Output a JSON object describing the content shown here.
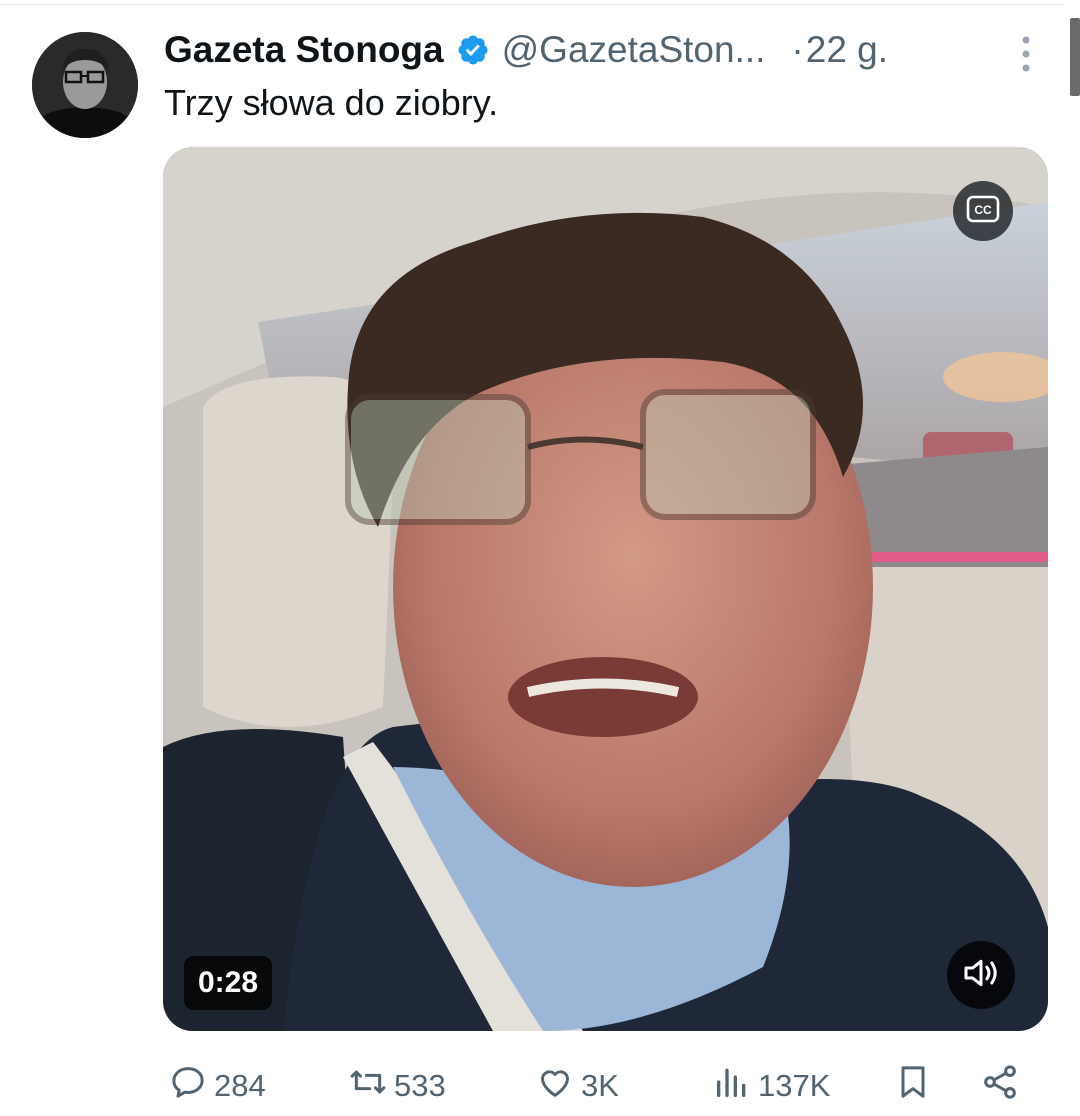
{
  "tweet": {
    "author_name": "Gazeta Stonoga",
    "author_handle": "@GazetaSton...",
    "separator": "·",
    "time": "22 g.",
    "text": "Trzy słowa do ziobry."
  },
  "video": {
    "duration": "0:28",
    "captions_icon": "cc-icon",
    "sound_icon": "speaker-icon"
  },
  "actions": {
    "replies": "284",
    "reposts": "533",
    "likes": "3K",
    "views": "137K"
  },
  "colors": {
    "verified": "#1d9bf0",
    "secondary_text": "#536471",
    "primary_text": "#0f1419"
  }
}
